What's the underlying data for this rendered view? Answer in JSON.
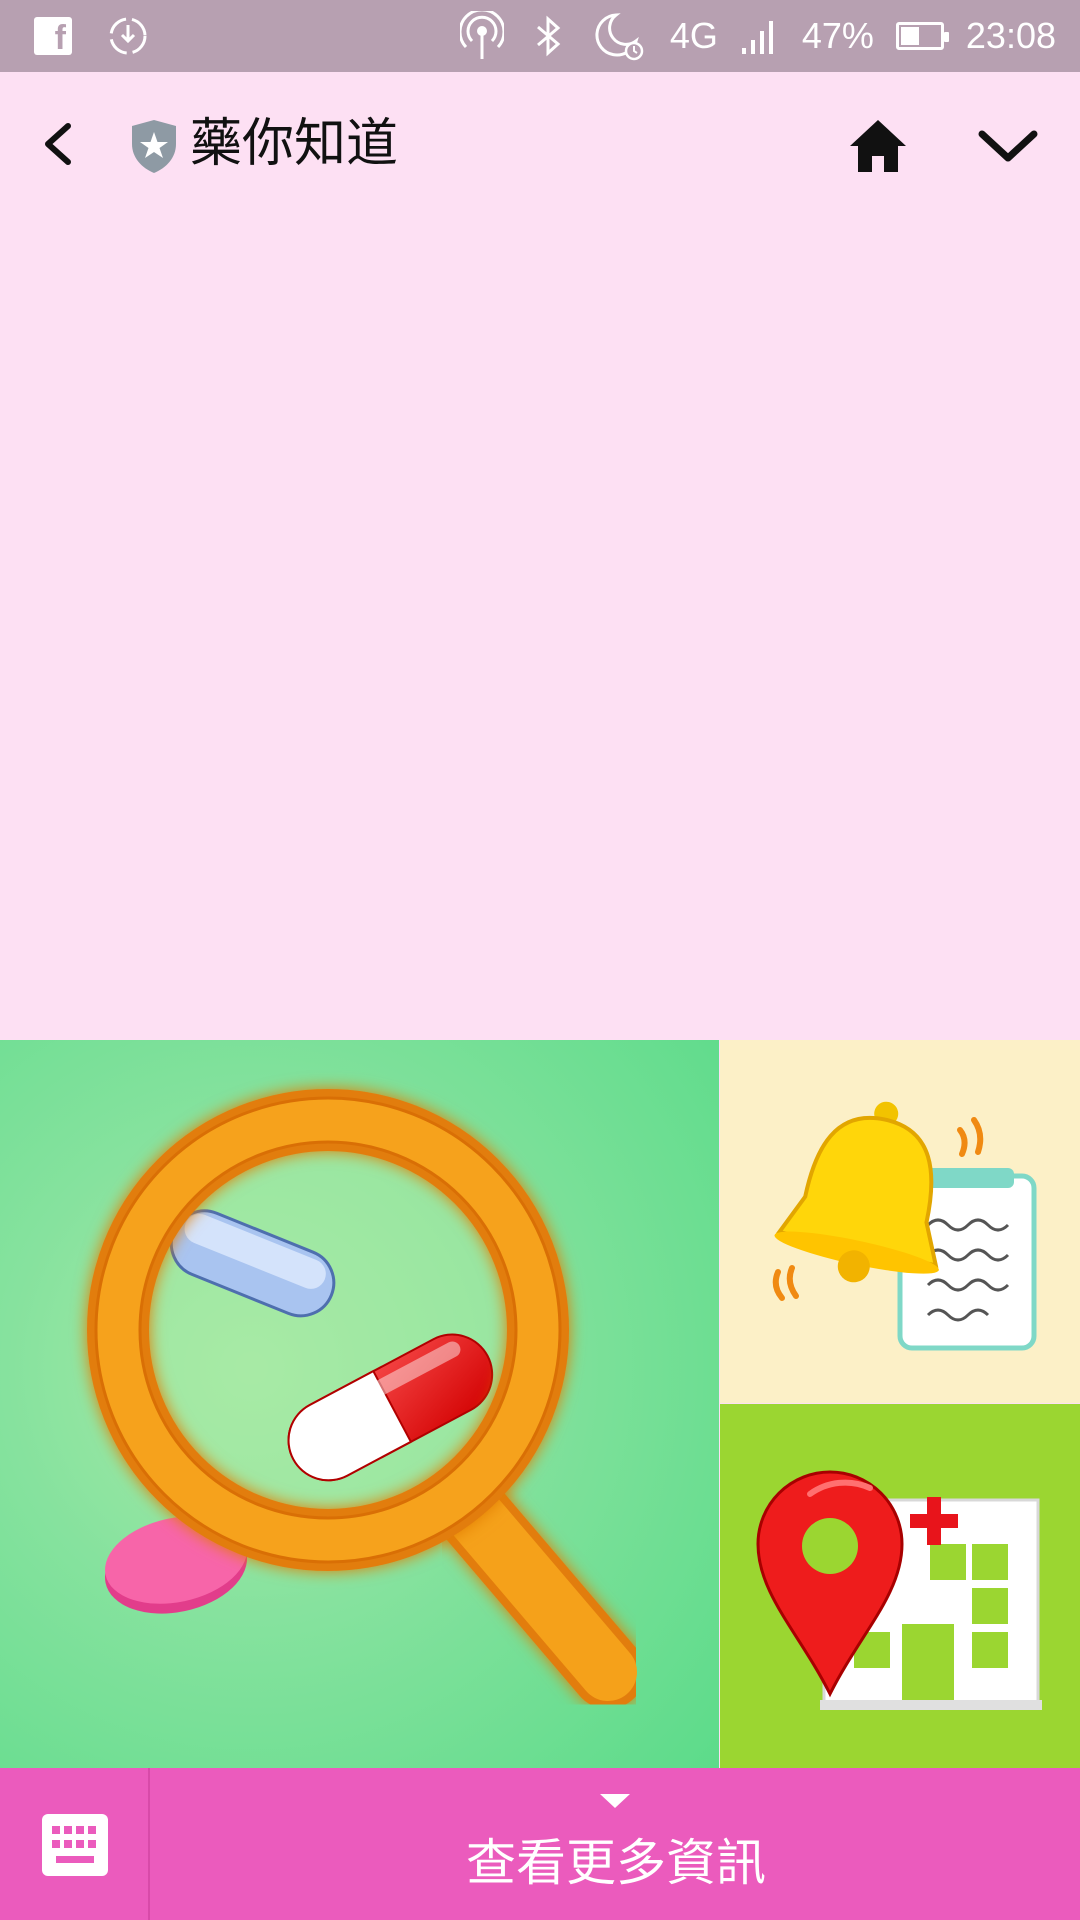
{
  "status_bar": {
    "battery_percent": "47%",
    "battery_level": 0.47,
    "network": "4G",
    "time": "23:08",
    "icons": [
      "facebook-icon",
      "sync-icon",
      "hotspot-icon",
      "bluetooth-icon",
      "do-not-disturb-alarm-icon",
      "signal-icon",
      "battery-icon"
    ]
  },
  "header": {
    "title": "藥你知道",
    "icons": [
      "back-arrow-icon",
      "shield-star-icon",
      "home-icon",
      "chevron-down-icon"
    ]
  },
  "tiles": [
    {
      "name": "drug-search-tile",
      "icon": "magnifier-pills-icon"
    },
    {
      "name": "reminder-tile",
      "icon": "bell-clipboard-icon"
    },
    {
      "name": "hospital-locator-tile",
      "icon": "map-pin-hospital-icon"
    }
  ],
  "bottom_bar": {
    "more_info_label": "查看更多資訊",
    "icons": [
      "keyboard-icon",
      "triangle-down-icon"
    ]
  },
  "colors": {
    "status_bar": "#b7a0b1",
    "background": "#fde0f3",
    "main_tile": "#6ae08f",
    "bell_tile": "#fcf0c7",
    "hospital_tile": "#9bd631",
    "bottom_bar": "#eb5bbd"
  }
}
